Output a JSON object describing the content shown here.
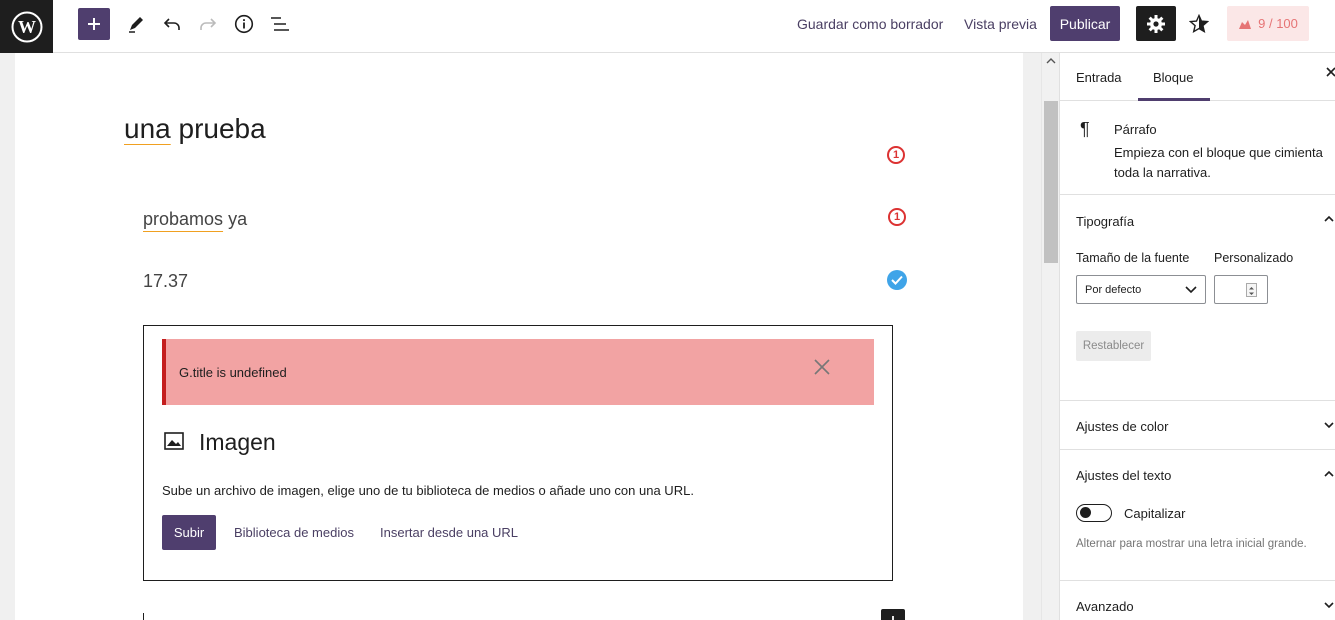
{
  "toolbar": {
    "save_draft": "Guardar como borrador",
    "preview": "Vista previa",
    "publish": "Publicar",
    "score": "9",
    "score_total": "100"
  },
  "editor": {
    "title_word1": "una",
    "title_word2": "prueba",
    "para1_word1": "probamos",
    "para1_word2": "ya",
    "para2": "17.37",
    "badge1": "1",
    "badge2": "1",
    "image_block": {
      "error": "G.title is undefined",
      "title": "Imagen",
      "description": "Sube un archivo de imagen, elige uno de tu biblioteca de medios o añade uno con una URL.",
      "upload": "Subir",
      "media_library": "Biblioteca de medios",
      "insert_url": "Insertar desde una URL"
    }
  },
  "sidebar": {
    "tabs": [
      "Entrada",
      "Bloque"
    ],
    "active_tab": "Bloque",
    "block": {
      "name": "Párrafo",
      "description": "Empieza con el bloque que cimienta toda la narrativa."
    },
    "typography": {
      "title": "Tipografía",
      "font_size_label": "Tamaño de la fuente",
      "custom_label": "Personalizado",
      "select_value": "Por defecto",
      "reset": "Restablecer"
    },
    "color_settings": "Ajustes de color",
    "text_settings": {
      "title": "Ajustes del texto",
      "toggle_label": "Capitalizar",
      "help": "Alternar para mostrar una letra inicial grande."
    },
    "advanced": "Avanzado"
  },
  "colors": {
    "accent": "#4f3e6e",
    "error_bg": "#f2a3a3",
    "error_border": "#c41e1e",
    "badge_red": "#dc3232",
    "badge_blue": "#3fa4e8",
    "score_text": "#e67475"
  }
}
